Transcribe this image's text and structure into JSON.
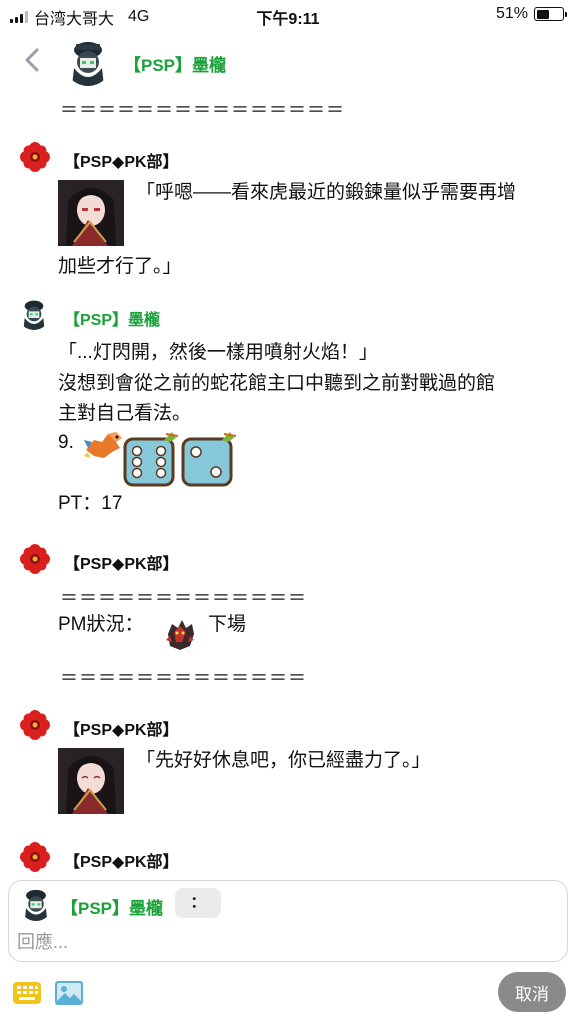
{
  "status_bar": {
    "carrier": "台湾大哥大",
    "network": "4G",
    "time": "下午9:11",
    "battery_percent": "51%",
    "battery_level": 0.51
  },
  "header": {
    "back_icon": "chevron-left-icon",
    "title": "【PSP】墨櫳"
  },
  "separators": {
    "top": "＝＝＝＝＝＝＝＝＝＝＝＝＝＝＝",
    "mid": "＝＝＝＝＝＝＝＝＝＝＝＝＝",
    "bottom": "＝＝＝＝＝＝＝＝＝＝＝＝＝"
  },
  "messages": [
    {
      "user": "【PSP◆PK部】",
      "lines": [
        "「呼嗯——看來虎最近的鍛鍊量似乎需要再增",
        "加些才行了。」"
      ]
    },
    {
      "user": "【PSP】墨櫳",
      "lines": [
        "「...灯閃開，然後一樣用噴射火焰！」",
        "沒想到會從之前的蛇花館主口中聽到之前對戰過的館",
        "主對自己看法。"
      ],
      "roll_label": "9.",
      "pt": "PT：17"
    },
    {
      "user": "【PSP◆PK部】",
      "pm_label": "PM狀況：",
      "pm_status": "下場"
    },
    {
      "user": "【PSP◆PK部】",
      "lines": [
        "「先好好休息吧，你已經盡力了。」"
      ]
    },
    {
      "user": "【PSP◆PK部】"
    }
  ],
  "composer": {
    "name": "【PSP】墨櫳",
    "colon_button": "：",
    "placeholder": "回應..."
  },
  "bottom_bar": {
    "keyboard_icon": "keyboard-icon",
    "image_icon": "image-icon",
    "cancel_label": "取消"
  },
  "colors": {
    "name_green": "#1aa23a",
    "flower_red": "#d9201f",
    "keyboard_yellow": "#f2c318",
    "image_blue": "#5bb0d6",
    "dice_blue": "#86c7d9"
  }
}
